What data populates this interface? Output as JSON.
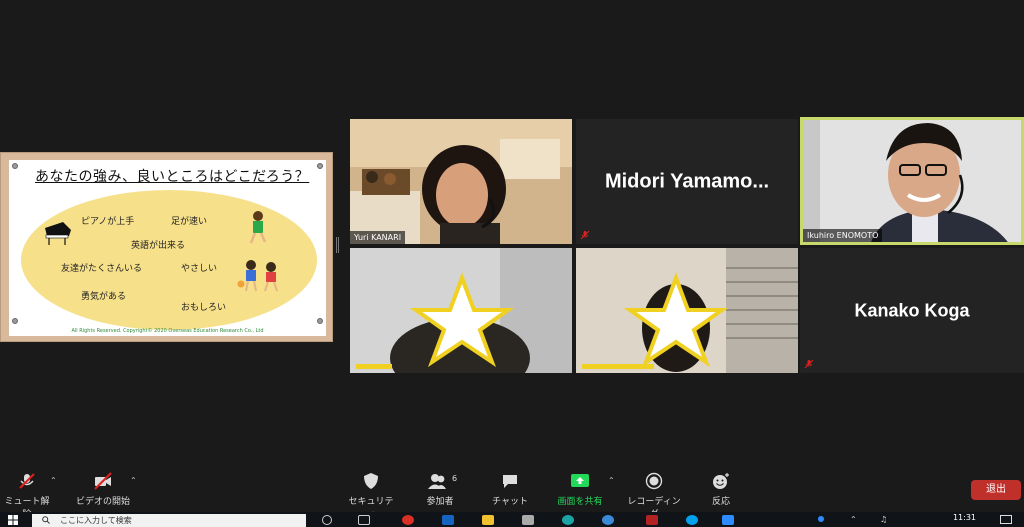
{
  "slide": {
    "title": "あなたの強み、良いところはどこだろう？",
    "items": [
      "ピアノが上手",
      "足が速い",
      "英語が出来る",
      "友達がたくさんいる",
      "やさしい",
      "勇気がある",
      "おもしろい"
    ],
    "copyright": "All Rights Reserved. Copyright© 2020 Overseas Education Research Co., Ltd"
  },
  "participants": [
    {
      "name": "Yuri KANARI"
    },
    {
      "name": "Midori Yamamo..."
    },
    {
      "name": "Ikuhiro ENOMOTO"
    },
    {
      "name": ""
    },
    {
      "name": ""
    },
    {
      "name": "Kanako Koga"
    }
  ],
  "toolbar": {
    "mute_label": "ミュート解除",
    "video_label": "ビデオの開始",
    "security_label": "セキュリティ",
    "participants_label": "参加者",
    "participants_count": "6",
    "chat_label": "チャット",
    "share_label": "画面を共有",
    "record_label": "レコーディング",
    "reactions_label": "反応",
    "leave_label": "退出"
  },
  "taskbar": {
    "search_placeholder": "ここに入力して検索",
    "time": "11:31"
  },
  "colors": {
    "share_green": "#23d959",
    "leave_red": "#c0302b",
    "active_speaker": "#c9d86a",
    "mic_off_red": "#e02020"
  }
}
